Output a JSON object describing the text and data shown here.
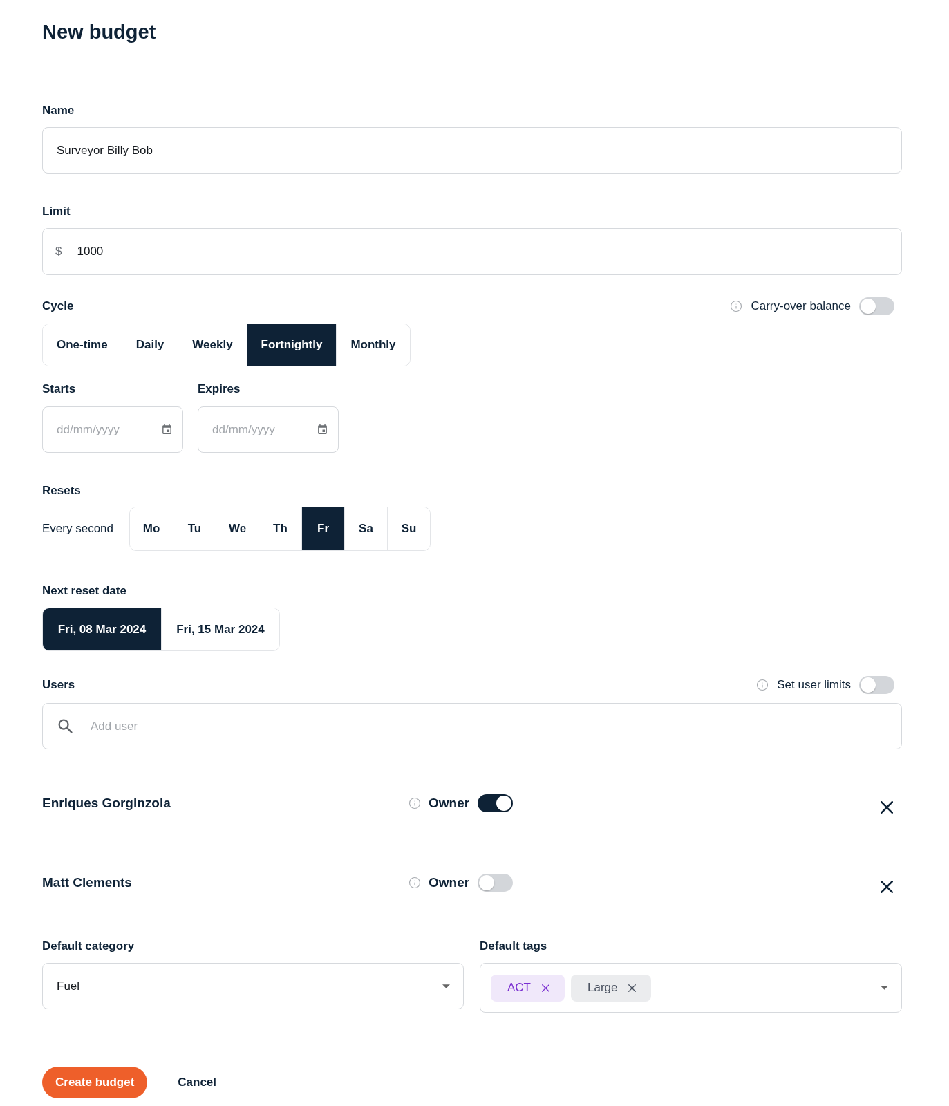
{
  "title": "New budget",
  "name_field": {
    "label": "Name",
    "value": "Surveyor Billy Bob"
  },
  "limit_field": {
    "label": "Limit",
    "prefix": "$",
    "value": "1000"
  },
  "cycle": {
    "label": "Cycle",
    "carry_over": {
      "label": "Carry-over balance",
      "on": false
    },
    "options": [
      {
        "label": "One-time",
        "selected": false
      },
      {
        "label": "Daily",
        "selected": false
      },
      {
        "label": "Weekly",
        "selected": false
      },
      {
        "label": "Fortnightly",
        "selected": true
      },
      {
        "label": "Monthly",
        "selected": false
      }
    ]
  },
  "dates": [
    {
      "label": "Starts",
      "placeholder": "dd/mm/yyyy"
    },
    {
      "label": "Expires",
      "placeholder": "dd/mm/yyyy"
    }
  ],
  "resets": {
    "label": "Resets",
    "prefix": "Every second",
    "days": [
      {
        "label": "Mo",
        "selected": false
      },
      {
        "label": "Tu",
        "selected": false
      },
      {
        "label": "We",
        "selected": false
      },
      {
        "label": "Th",
        "selected": false
      },
      {
        "label": "Fr",
        "selected": true
      },
      {
        "label": "Sa",
        "selected": false
      },
      {
        "label": "Su",
        "selected": false
      }
    ]
  },
  "next_reset": {
    "label": "Next reset date",
    "options": [
      {
        "label": "Fri, 08 Mar 2024",
        "selected": true
      },
      {
        "label": "Fri, 15 Mar 2024",
        "selected": false
      }
    ]
  },
  "users": {
    "label": "Users",
    "user_limits": {
      "label": "Set user limits",
      "on": false
    },
    "search": {
      "placeholder": "Add user"
    },
    "list": [
      {
        "name": "Enriques Gorginzola",
        "owner_label": "Owner",
        "owner": true
      },
      {
        "name": "Matt Clements",
        "owner_label": "Owner",
        "owner": false
      }
    ]
  },
  "default_category": {
    "label": "Default category",
    "value": "Fuel"
  },
  "default_tags": {
    "label": "Default tags",
    "tags": [
      {
        "label": "ACT",
        "color": "#7a2ed1"
      },
      {
        "label": "Large",
        "color": "#4a5260"
      }
    ]
  },
  "actions": [
    {
      "kind": "primary",
      "label": "Create budget"
    },
    {
      "kind": "link",
      "label": "Cancel"
    }
  ]
}
